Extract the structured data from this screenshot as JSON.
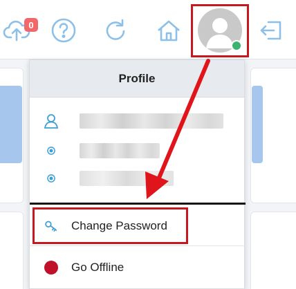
{
  "header": {
    "sync_badge_count": "0",
    "icons": [
      "cloud-upload-icon",
      "help-icon",
      "refresh-icon",
      "home-icon",
      "logout-icon"
    ],
    "status_color": "#3cb371"
  },
  "profile_menu": {
    "title": "Profile",
    "change_password_label": "Change Password",
    "go_offline_label": "Go Offline",
    "accent_color": "#3b9fd6",
    "offline_color": "#c0102a"
  },
  "annotation_color": "#c8181f"
}
